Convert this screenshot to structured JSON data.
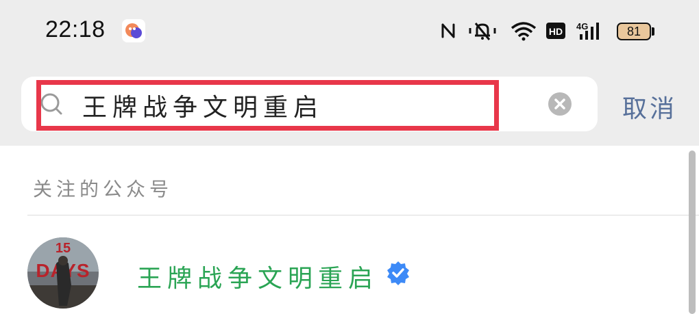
{
  "status_bar": {
    "time": "22:18",
    "battery_level": "81",
    "icons": [
      "app-notification-icon",
      "nfc-icon",
      "silent-vibrate-icon",
      "wifi-icon",
      "hd-icon",
      "4g-signal-icon",
      "battery-icon"
    ],
    "network_label": "4G",
    "hd_label": "HD"
  },
  "search": {
    "query": "王牌战争文明重启",
    "highlight_color": "#e8374a",
    "cancel_label": "取消"
  },
  "results": {
    "section_label": "关注的公众号",
    "items": [
      {
        "name": "王牌战争文明重启",
        "verified": true,
        "avatar_text": "15 DAYS"
      }
    ]
  },
  "colors": {
    "accent_green": "#2aa454",
    "link_blue": "#57709a",
    "verified_blue": "#3d8af7"
  }
}
